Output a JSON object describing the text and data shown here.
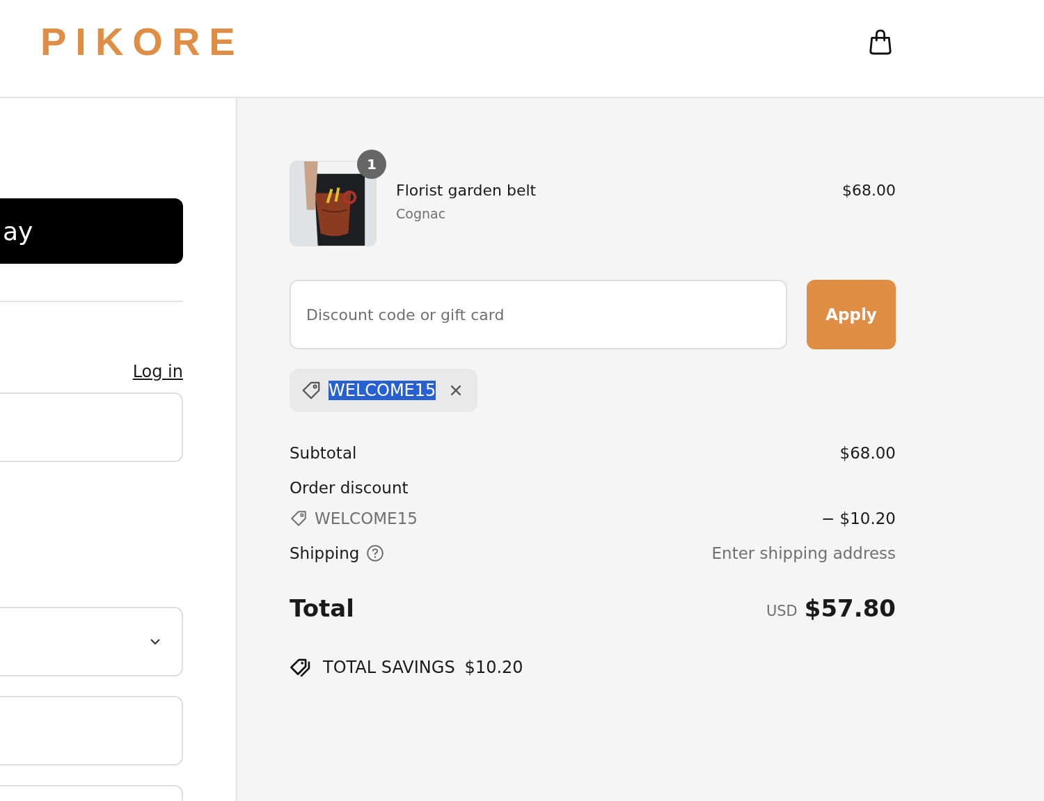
{
  "header": {
    "logo": "PIKORE"
  },
  "left": {
    "pay_button": "ay",
    "login_link": "Log in",
    "fields": [
      {
        "kind": "text"
      },
      {
        "kind": "select"
      },
      {
        "kind": "text"
      },
      {
        "kind": "text"
      }
    ]
  },
  "summary": {
    "item": {
      "quantity": "1",
      "name": "Florist garden belt",
      "variant": "Cognac",
      "price": "$68.00"
    },
    "discount": {
      "placeholder": "Discount code or gift card",
      "button": "Apply"
    },
    "applied_code": {
      "code": "WELCOME15",
      "selected": true
    },
    "subtotal": {
      "label": "Subtotal",
      "value": "$68.00"
    },
    "order_discount": {
      "label": "Order discount",
      "code": "WELCOME15",
      "value": "− $10.20"
    },
    "shipping": {
      "label": "Shipping",
      "value": "Enter shipping address"
    },
    "total": {
      "label": "Total",
      "currency": "USD",
      "value": "$57.80"
    },
    "savings": {
      "label": "TOTAL SAVINGS",
      "value": "$10.20"
    }
  }
}
